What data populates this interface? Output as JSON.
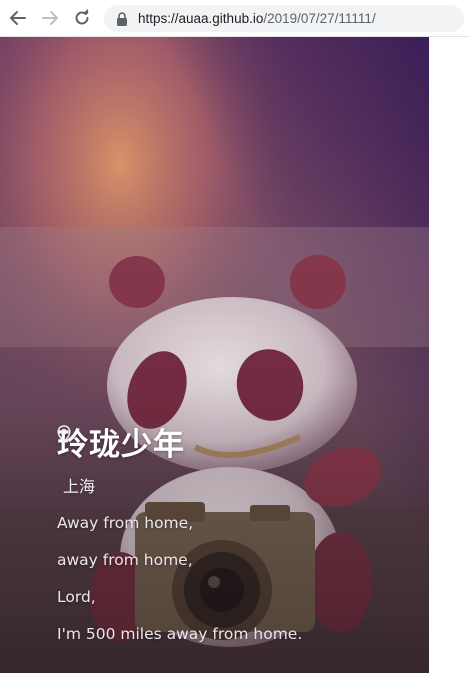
{
  "browser": {
    "icons": {
      "back": "arrow-left-icon",
      "forward": "arrow-right-icon",
      "reload": "reload-icon",
      "lock": "lock-icon"
    },
    "url_host": "https://auaa.github.io",
    "url_path": "/2019/07/27/11111/"
  },
  "profile": {
    "name": "玲珑少年",
    "location_icon": "map-pin-icon",
    "location": "上海",
    "bio_lines": [
      "Away from home,",
      "away from home,",
      "Lord,",
      "I'm 500 miles away from home."
    ]
  },
  "colors": {
    "overlay_purple": "#5d3a55",
    "text_white": "#ffffff"
  }
}
